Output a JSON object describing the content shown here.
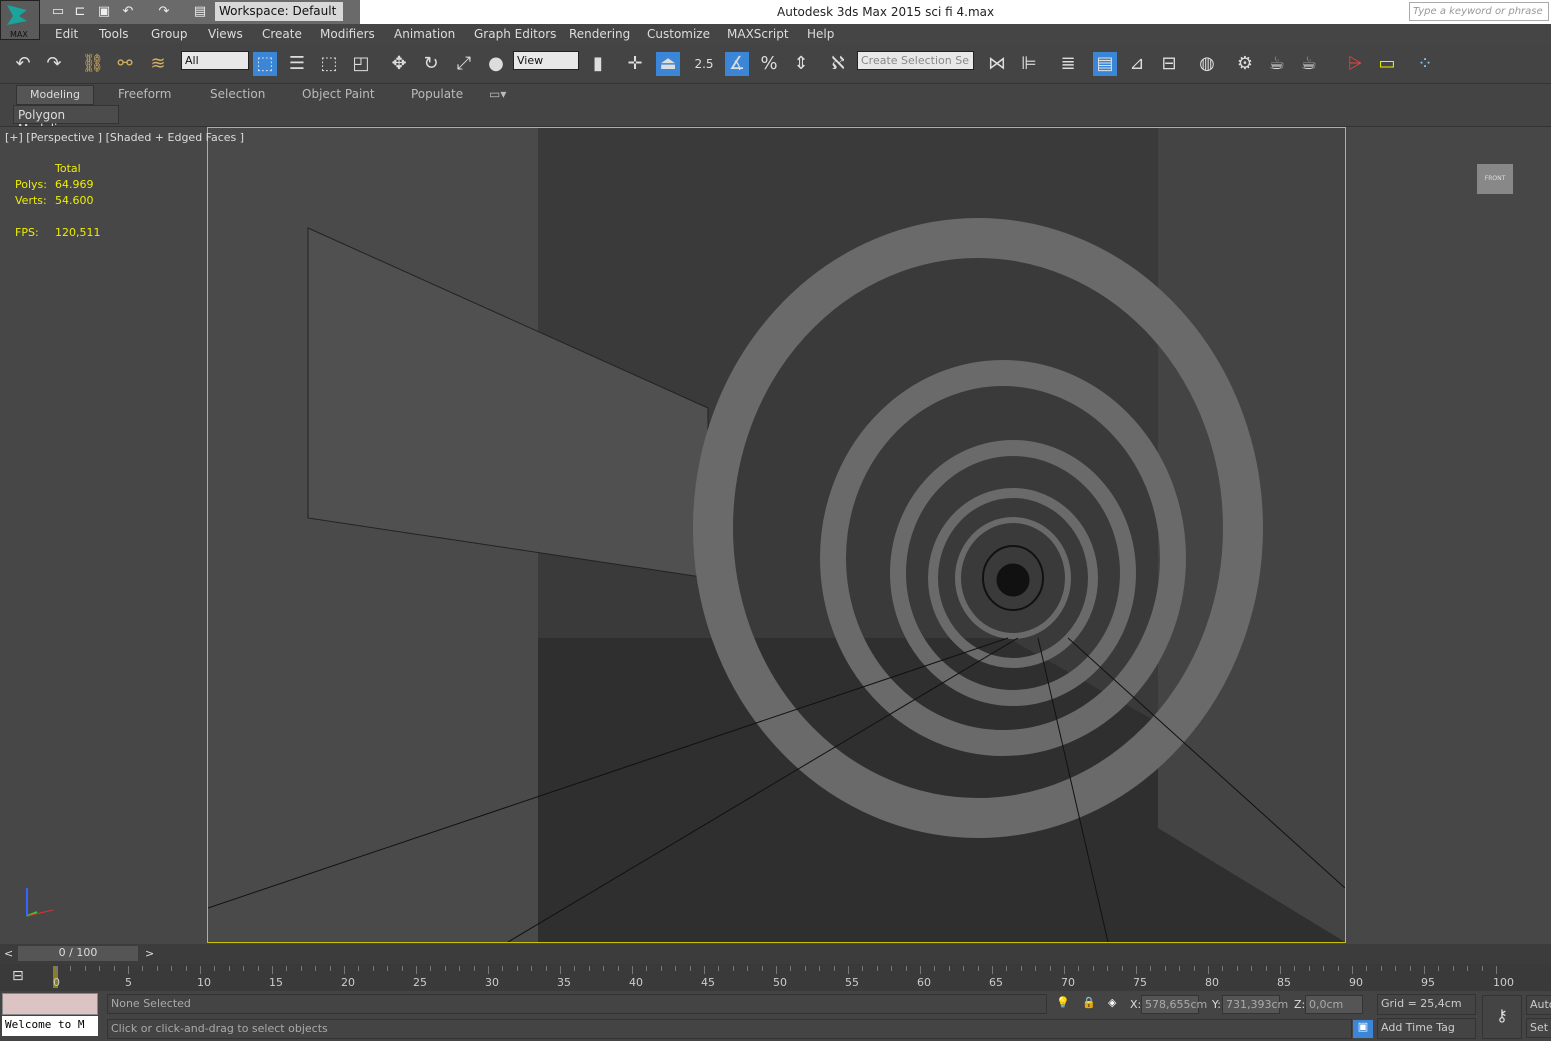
{
  "app": {
    "logo_label": "MAX",
    "title": "Autodesk 3ds Max  2015     sci fi 4.max",
    "workspace": "Workspace: Default",
    "search_placeholder": "Type a keyword or phrase"
  },
  "menu": [
    "Edit",
    "Tools",
    "Group",
    "Views",
    "Create",
    "Modifiers",
    "Animation",
    "Graph Editors",
    "Rendering",
    "Customize",
    "MAXScript",
    "Help"
  ],
  "toolbar": {
    "selection_filter": "All",
    "ref_coord": "View",
    "snap_angle": "2.5",
    "named_selection": "Create Selection Se"
  },
  "ribbon": {
    "tabs": [
      "Modeling",
      "Freeform",
      "Selection",
      "Object Paint",
      "Populate"
    ],
    "active_tab": "Modeling",
    "panel": "Polygon Modeling"
  },
  "viewport": {
    "label": "[+] [Perspective ] [Shaded + Edged Faces ]",
    "stats": {
      "header": "Total",
      "polys_label": "Polys:",
      "polys": "64.969",
      "verts_label": "Verts:",
      "verts": "54.600",
      "fps_label": "FPS:",
      "fps": "120,511"
    },
    "viewcube": "FRONT",
    "border_color": "#c8c000"
  },
  "timeline": {
    "frame": "0 / 100",
    "prev": "<",
    "next": ">",
    "ticks": [
      "0",
      "5",
      "10",
      "15",
      "20",
      "25",
      "30",
      "35",
      "40",
      "45",
      "50",
      "55",
      "60",
      "65",
      "70",
      "75",
      "80",
      "85",
      "90",
      "95",
      "100"
    ]
  },
  "status": {
    "listener": "Welcome to M",
    "selection": "None Selected",
    "prompt": "Click or click-and-drag to select objects",
    "x_label": "X:",
    "x": "578,655cm",
    "y_label": "Y:",
    "y": "731,393cm",
    "z_label": "Z:",
    "z": "0,0cm",
    "grid": "Grid = 25,4cm",
    "time_tag": "Add Time Tag",
    "auto": "Auto",
    "set": "Set"
  }
}
